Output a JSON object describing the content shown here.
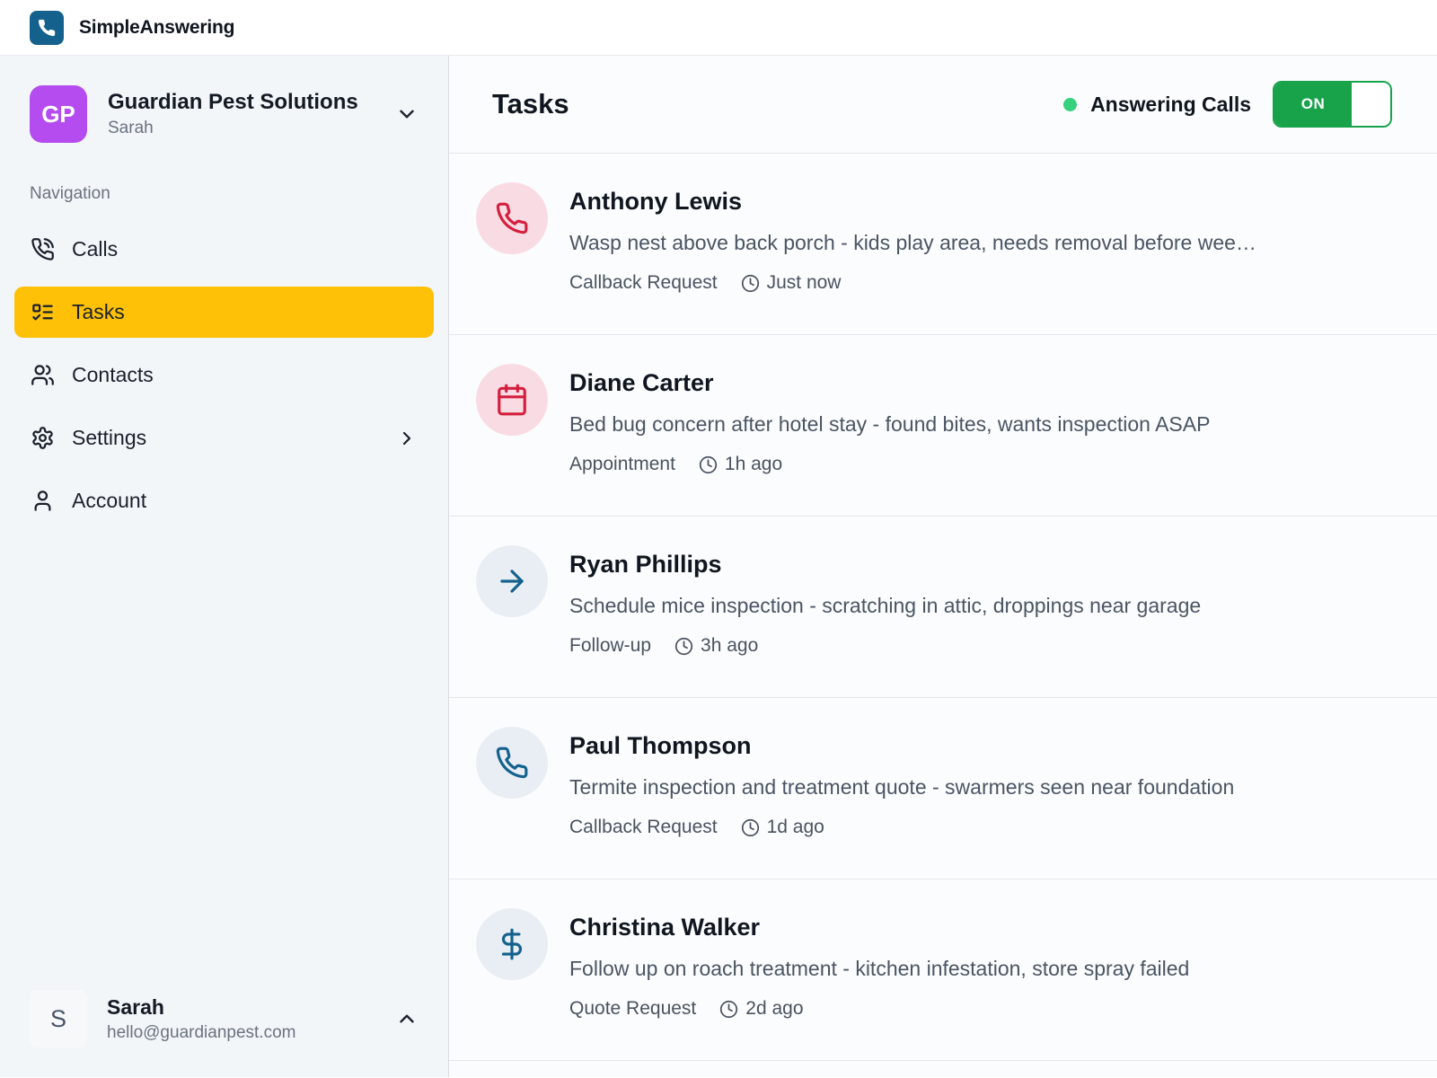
{
  "app": {
    "name": "SimpleAnswering",
    "logo_icon": "phone-icon"
  },
  "workspace": {
    "initials": "GP",
    "name": "Guardian Pest Solutions",
    "subtitle": "Sarah",
    "chevron": "chevron-down-icon"
  },
  "sidebar": {
    "section_label": "Navigation",
    "items": [
      {
        "label": "Calls",
        "icon": "phone-call-icon",
        "active": false
      },
      {
        "label": "Tasks",
        "icon": "checklist-icon",
        "active": true
      },
      {
        "label": "Contacts",
        "icon": "users-icon",
        "active": false
      },
      {
        "label": "Settings",
        "icon": "gear-icon",
        "active": false,
        "has_submenu": true
      },
      {
        "label": "Account",
        "icon": "person-icon",
        "active": false
      }
    ]
  },
  "user": {
    "initial": "S",
    "name": "Sarah",
    "email": "hello@guardianpest.com",
    "chevron": "chevron-up-icon"
  },
  "main": {
    "title": "Tasks",
    "status": {
      "label": "Answering Calls",
      "state": "on",
      "toggle_on_label": "ON"
    },
    "tasks": [
      {
        "name": "Anthony Lewis",
        "description": "Wasp nest above back porch - kids play area, needs removal before wee…",
        "type": "Callback Request",
        "time": "Just now",
        "icon": "phone-icon",
        "theme": "red"
      },
      {
        "name": "Diane Carter",
        "description": "Bed bug concern after hotel stay - found bites, wants inspection ASAP",
        "type": "Appointment",
        "time": "1h ago",
        "icon": "calendar-icon",
        "theme": "red"
      },
      {
        "name": "Ryan Phillips",
        "description": "Schedule mice inspection - scratching in attic, droppings near garage",
        "type": "Follow-up",
        "time": "3h ago",
        "icon": "arrow-right-icon",
        "theme": "blue"
      },
      {
        "name": "Paul Thompson",
        "description": "Termite inspection and treatment quote - swarmers seen near foundation",
        "type": "Callback Request",
        "time": "1d ago",
        "icon": "phone-icon",
        "theme": "blue"
      },
      {
        "name": "Christina Walker",
        "description": "Follow up on roach treatment - kitchen infestation, store spray failed",
        "type": "Quote Request",
        "time": "2d ago",
        "icon": "dollar-icon",
        "theme": "blue"
      }
    ]
  },
  "colors": {
    "brand_blue": "#15618e",
    "workspace_purple": "#b44cf0",
    "active_yellow": "#ffc107",
    "toggle_green": "#18a34b",
    "status_dot_green": "#35d17c",
    "task_red": "#d41f3e",
    "task_red_bg": "#f9dce3",
    "task_blue": "#15618e",
    "task_blue_bg": "#e8eef4",
    "sidebar_bg": "#f3f6f8",
    "main_bg": "#fbfcfd"
  }
}
